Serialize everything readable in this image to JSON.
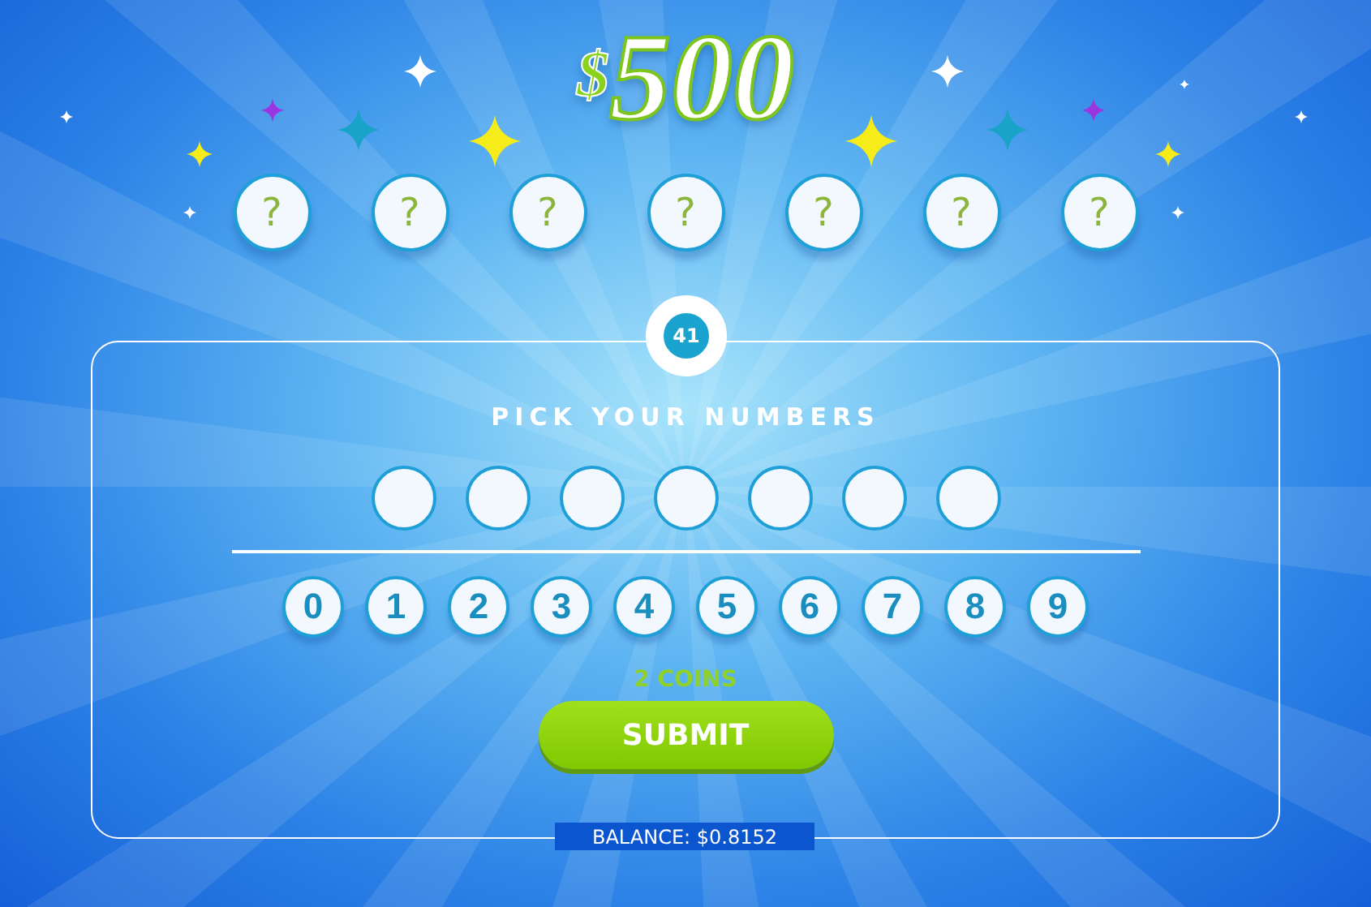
{
  "jackpot": {
    "currency": "$",
    "amount": "500"
  },
  "draw_balls": [
    "?",
    "?",
    "?",
    "?",
    "?",
    "?",
    "?"
  ],
  "ticket_badge": "41",
  "panel": {
    "heading": "PICK YOUR NUMBERS",
    "picked": [
      {
        "filled": false
      },
      {
        "filled": false
      },
      {
        "filled": false
      },
      {
        "filled": false
      },
      {
        "filled": false
      },
      {
        "filled": false
      },
      {
        "filled": false
      }
    ],
    "digits": [
      "0",
      "1",
      "2",
      "3",
      "4",
      "5",
      "6",
      "7",
      "8",
      "9"
    ],
    "cost": "2 COINS",
    "submit": "SUBMIT",
    "balance": "BALANCE: $0.8152"
  }
}
